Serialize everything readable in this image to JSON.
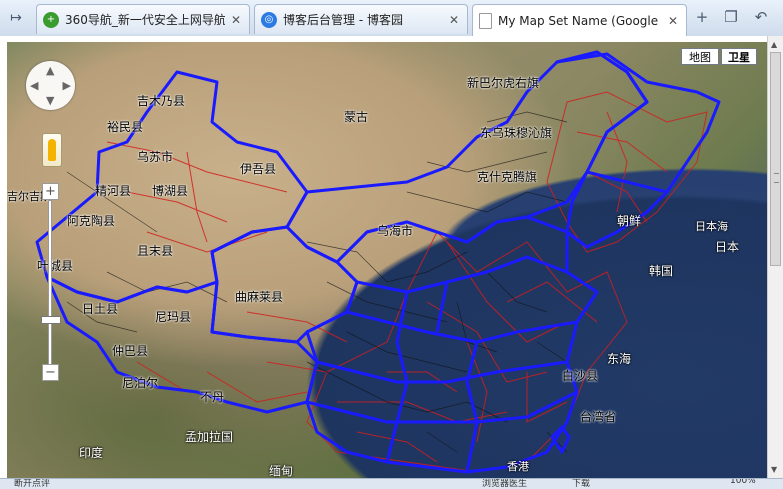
{
  "tabs": [
    {
      "label": "360导航_新一代安全上网导航",
      "icon": "360-logo-icon",
      "color": "#3a9b2f"
    },
    {
      "label": "博客后台管理 - 博客园",
      "icon": "cnblogs-logo-icon",
      "color": "#2c7be5"
    },
    {
      "label": "My Map Set Name (Google",
      "icon": "page-icon",
      "color": "#ffffff"
    }
  ],
  "map": {
    "map_type_map": "地图",
    "map_type_satellite": "卫星",
    "zoom_in": "+",
    "zoom_out": "−",
    "labels": [
      {
        "text": "吉木乃县"
      },
      {
        "text": "裕民县"
      },
      {
        "text": "乌苏市"
      },
      {
        "text": "精河县"
      },
      {
        "text": "博湖县"
      },
      {
        "text": "伊吾县"
      },
      {
        "text": "阿克陶县"
      },
      {
        "text": "且末县"
      },
      {
        "text": "叶城县"
      },
      {
        "text": "日土县"
      },
      {
        "text": "尼玛县"
      },
      {
        "text": "仲巴县"
      },
      {
        "text": "尼泊尔"
      },
      {
        "text": "不丹"
      },
      {
        "text": "孟加拉国"
      },
      {
        "text": "印度"
      },
      {
        "text": "缅甸"
      },
      {
        "text": "蒙古"
      },
      {
        "text": "新巴尔虎右旗"
      },
      {
        "text": "东乌珠穆沁旗"
      },
      {
        "text": "克什克腾旗"
      },
      {
        "text": "乌海市"
      },
      {
        "text": "曲麻莱县"
      },
      {
        "text": "朝鲜"
      },
      {
        "text": "韩国"
      },
      {
        "text": "日本海"
      },
      {
        "text": "日本"
      },
      {
        "text": "东海"
      },
      {
        "text": "台湾省"
      },
      {
        "text": "香港"
      },
      {
        "text": "吉尔吉斯"
      },
      {
        "text": "白沙县"
      }
    ],
    "accent_province_border": "#1a1aff",
    "accent_district_border": "#e0201a"
  },
  "status": {
    "left": "断开点评",
    "browser_doctor": "浏览器医生",
    "download": "下载",
    "zoom": "100%"
  }
}
